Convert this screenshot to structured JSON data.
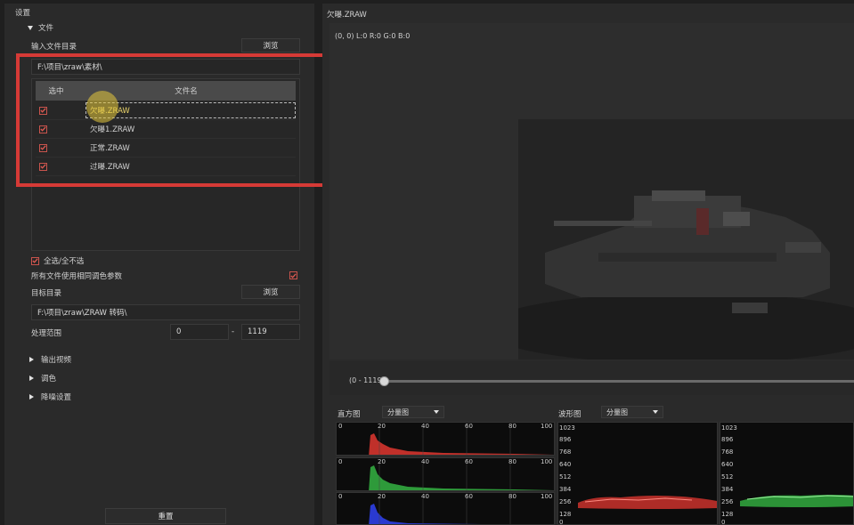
{
  "left": {
    "section_title": "设置",
    "file_group": "文件",
    "input_dir_label": "输入文件目录",
    "browse1": "浏览",
    "input_path": "F:\\项目\\zraw\\素材\\",
    "table": {
      "col_select": "选中",
      "col_name": "文件名",
      "rows": [
        {
          "name": "欠曝.ZRAW",
          "checked": true
        },
        {
          "name": "欠曝1.ZRAW",
          "checked": true
        },
        {
          "name": "正常.ZRAW",
          "checked": true
        },
        {
          "name": "过曝.ZRAW",
          "checked": true
        }
      ]
    },
    "select_all": "全选/全不选",
    "same_params": "所有文件使用相同调色参数",
    "target_dir_label": "目标目录",
    "browse2": "浏览",
    "target_path": "F:\\项目\\zraw\\ZRAW 转码\\",
    "range_label": "处理范围",
    "range_from": "0",
    "range_dash": "-",
    "range_to": "1119",
    "sections": [
      "输出视频",
      "调色",
      "降噪设置"
    ],
    "reset": "重置"
  },
  "right": {
    "preview_title": "欠曝.ZRAW",
    "pixel_info": "(0, 0) L:0 R:0 G:0 B:0",
    "timeline_range": "(0 - 1119)",
    "timeline_value": 0,
    "histogram_label": "直方图",
    "histogram_mode": "分量图",
    "waveform_label": "波形图",
    "waveform_mode": "分量图",
    "hist_ticks": [
      "0",
      "20",
      "40",
      "60",
      "80",
      "100"
    ],
    "wave_ticks": [
      "1023",
      "896",
      "768",
      "640",
      "512",
      "384",
      "256",
      "128",
      "0"
    ]
  },
  "colors": {
    "accent_red": "#d63a36",
    "hist_red": "#c0302a",
    "hist_green": "#2e9a3a",
    "hist_blue": "#2a3ad0"
  }
}
